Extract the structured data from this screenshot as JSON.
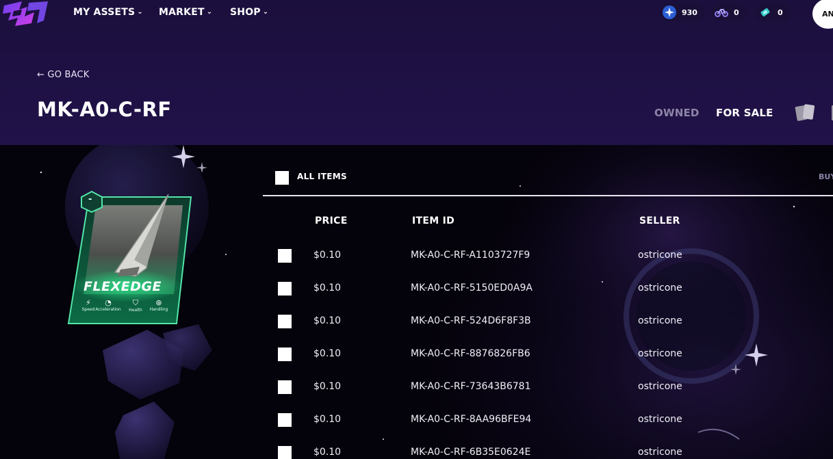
{
  "nav": {
    "items": [
      {
        "label": "MY ASSETS"
      },
      {
        "label": "MARKET"
      },
      {
        "label": "SHOP"
      }
    ]
  },
  "currencies": [
    {
      "icon": "star-coin-icon",
      "value": "930",
      "color": "#3d7df0"
    },
    {
      "icon": "bike-token-icon",
      "value": "0",
      "color": "#8d7cf0"
    },
    {
      "icon": "ticket-icon",
      "value": "0",
      "color": "#38c7c9"
    }
  ],
  "user": {
    "avatar_text": "AN"
  },
  "page": {
    "go_back": "← GO BACK",
    "title": "MK-A0-C-RF",
    "tabs": [
      {
        "label": "OWNED",
        "active": false
      },
      {
        "label": "FOR SALE",
        "active": true
      }
    ]
  },
  "card": {
    "name": "FLEXEDGE",
    "badge": "-",
    "stats": [
      {
        "label": "Speed",
        "icon": "lightning-icon"
      },
      {
        "label": "Acceleration",
        "icon": "gauge-icon"
      },
      {
        "label": "Health",
        "icon": "shield-plus-icon"
      },
      {
        "label": "Handling",
        "icon": "steering-wheel-icon"
      }
    ],
    "accent": "#2fe08a"
  },
  "listing": {
    "select_all_label": "ALL ITEMS",
    "buy_label": "BUY",
    "columns": {
      "price": "PRICE",
      "item_id": "ITEM ID",
      "seller": "SELLER"
    },
    "rows": [
      {
        "price": "$0.10",
        "item_id": "MK-A0-C-RF-A1103727F9",
        "seller": "ostricone"
      },
      {
        "price": "$0.10",
        "item_id": "MK-A0-C-RF-5150ED0A9A",
        "seller": "ostricone"
      },
      {
        "price": "$0.10",
        "item_id": "MK-A0-C-RF-524D6F8F3B",
        "seller": "ostricone"
      },
      {
        "price": "$0.10",
        "item_id": "MK-A0-C-RF-8876826FB6",
        "seller": "ostricone"
      },
      {
        "price": "$0.10",
        "item_id": "MK-A0-C-RF-73643B6781",
        "seller": "ostricone"
      },
      {
        "price": "$0.10",
        "item_id": "MK-A0-C-RF-8AA96BFE94",
        "seller": "ostricone"
      },
      {
        "price": "$0.10",
        "item_id": "MK-A0-C-RF-6B35E0624E",
        "seller": "ostricone"
      }
    ]
  },
  "colors": {
    "header_bg": "#1e1044",
    "page_bg": "#05030c",
    "text": "#ffffff",
    "muted": "#8d85a8"
  }
}
